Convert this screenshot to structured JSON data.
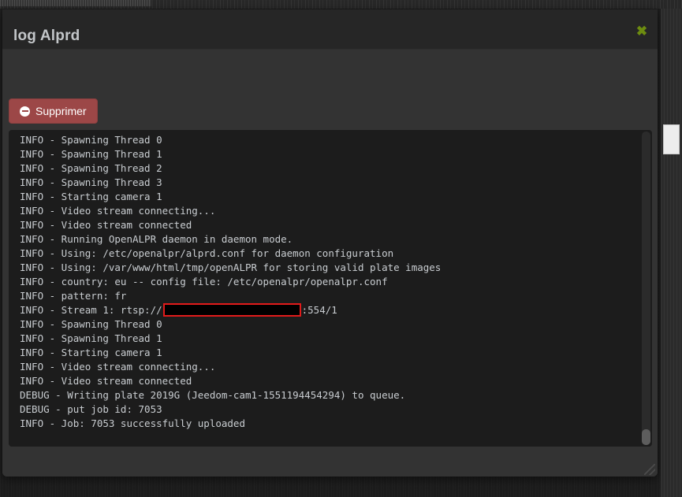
{
  "browser": {
    "chrome_strip": "browser-toolbar-strip"
  },
  "modal": {
    "title": "log Alprd",
    "close_label": "✖",
    "close_color": "#6d8c10"
  },
  "toolbar": {
    "delete_label": "Supprimer",
    "delete_icon": "minus-circle-icon",
    "delete_color": "#9c4747"
  },
  "log": {
    "background": "#1c1c1c",
    "text_color": "#c9cdd1",
    "redaction_border_color": "#e21b1b",
    "lines": [
      {
        "text": "INFO - Spawning Thread 0"
      },
      {
        "text": "INFO - Spawning Thread 1"
      },
      {
        "text": "INFO - Spawning Thread 2"
      },
      {
        "text": "INFO - Spawning Thread 3"
      },
      {
        "text": "INFO - Starting camera 1"
      },
      {
        "text": "INFO - Video stream connecting..."
      },
      {
        "text": "INFO - Video stream connected"
      },
      {
        "text": "INFO - Running OpenALPR daemon in daemon mode."
      },
      {
        "text": "INFO - Using: /etc/openalpr/alprd.conf for daemon configuration"
      },
      {
        "text": "INFO - Using: /var/www/html/tmp/openALPR for storing valid plate images"
      },
      {
        "text": "INFO - country: eu -- config file: /etc/openalpr/openalpr.conf"
      },
      {
        "text": "INFO - pattern: fr"
      },
      {
        "prefix": "INFO - Stream 1: rtsp://",
        "redacted": true,
        "suffix": ":554/1"
      },
      {
        "text": "INFO - Spawning Thread 0"
      },
      {
        "text": "INFO - Spawning Thread 1"
      },
      {
        "text": "INFO - Starting camera 1"
      },
      {
        "text": "INFO - Video stream connecting..."
      },
      {
        "text": "INFO - Video stream connected"
      },
      {
        "text": "DEBUG - Writing plate 2019G (Jeedom-cam1-1551194454294) to queue."
      },
      {
        "text": "DEBUG - put job id: 7053"
      },
      {
        "text": "INFO - Job: 7053 successfully uploaded"
      }
    ]
  }
}
